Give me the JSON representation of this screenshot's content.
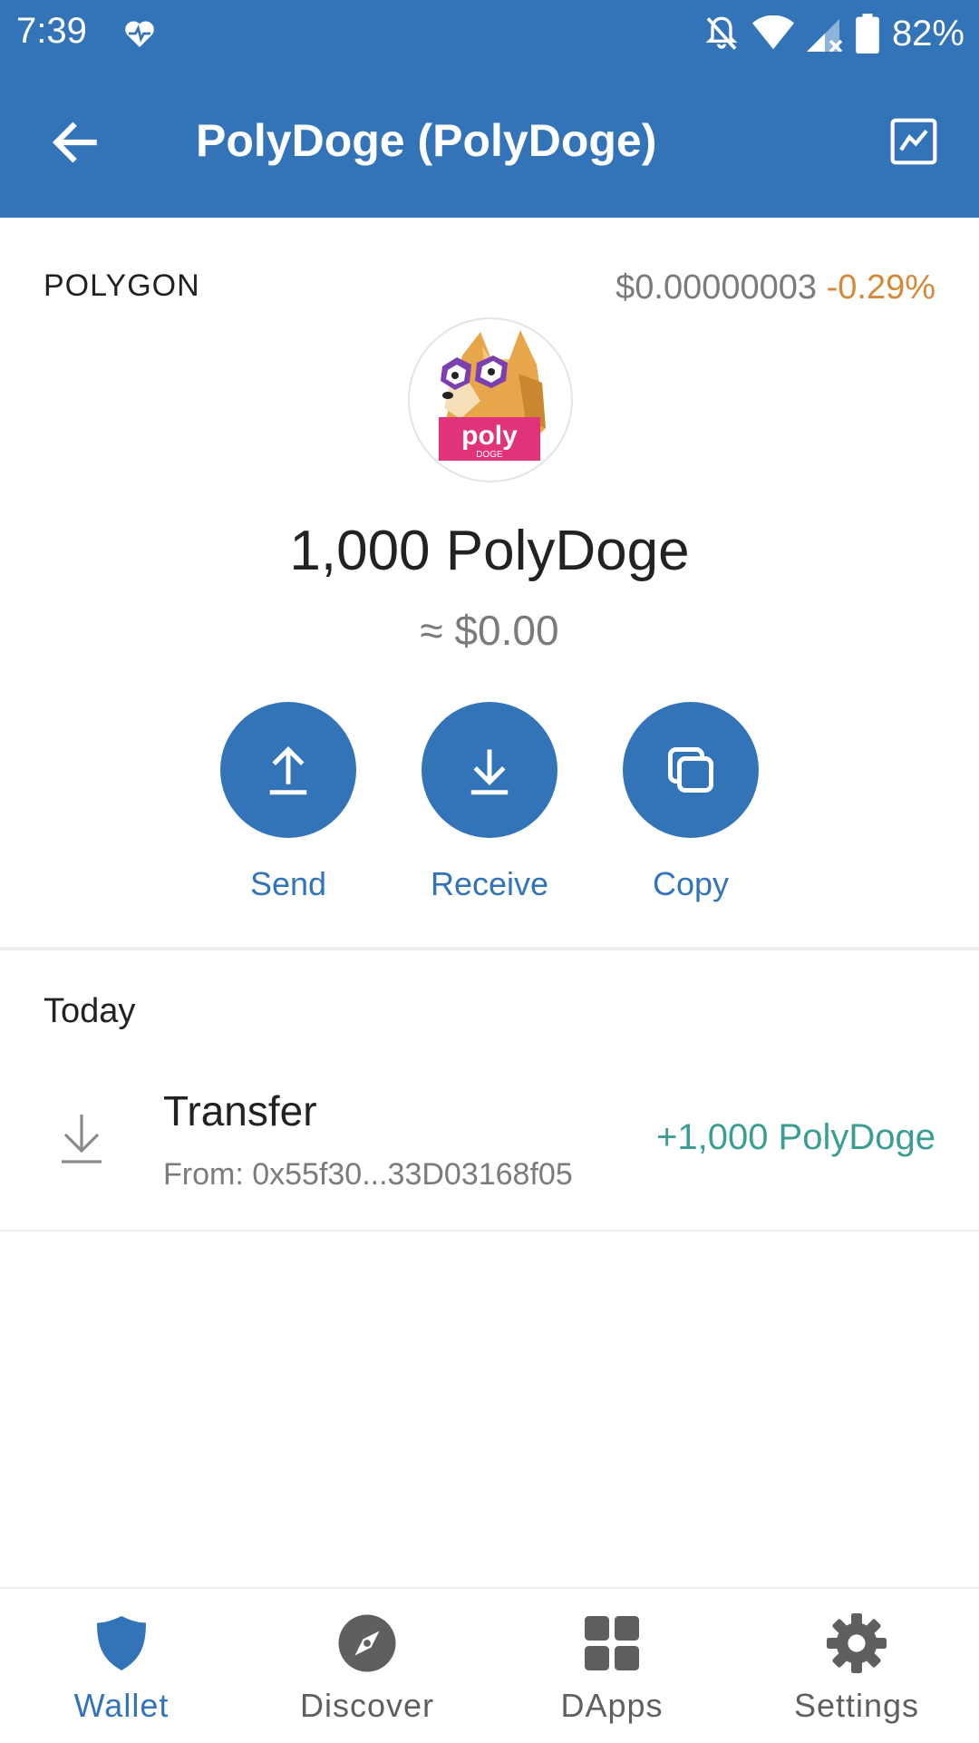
{
  "status_bar": {
    "time": "7:39",
    "battery": "82%",
    "icons": [
      "heart-pulse-icon",
      "notifications-off-icon",
      "wifi-icon",
      "cell-signal-icon",
      "battery-icon"
    ]
  },
  "app_bar": {
    "title": "PolyDoge (PolyDoge)",
    "back_icon": "arrow-left-icon",
    "chart_icon": "chart-icon"
  },
  "token": {
    "network": "POLYGON",
    "price": "$0.00000003",
    "change": "-0.29%",
    "logo_text": "poly",
    "logo_subtext": "DOGE",
    "balance": "1,000 PolyDoge",
    "fiat": "≈ $0.00"
  },
  "actions": [
    {
      "label": "Send",
      "icon": "upload-icon"
    },
    {
      "label": "Receive",
      "icon": "download-icon"
    },
    {
      "label": "Copy",
      "icon": "copy-icon"
    }
  ],
  "history": {
    "date_header": "Today",
    "transactions": [
      {
        "type": "Transfer",
        "from": "From: 0x55f30...33D03168f05",
        "amount": "+1,000 PolyDoge",
        "icon": "download-icon"
      }
    ]
  },
  "bottom_nav": [
    {
      "label": "Wallet",
      "icon": "shield-icon",
      "active": true
    },
    {
      "label": "Discover",
      "icon": "compass-icon",
      "active": false
    },
    {
      "label": "DApps",
      "icon": "grid-icon",
      "active": false
    },
    {
      "label": "Settings",
      "icon": "gear-icon",
      "active": false
    }
  ],
  "colors": {
    "primary": "#3374B9",
    "change_negative": "#D4893A",
    "amount_positive": "#3C9E92",
    "logo_badge": "#E0337A"
  }
}
